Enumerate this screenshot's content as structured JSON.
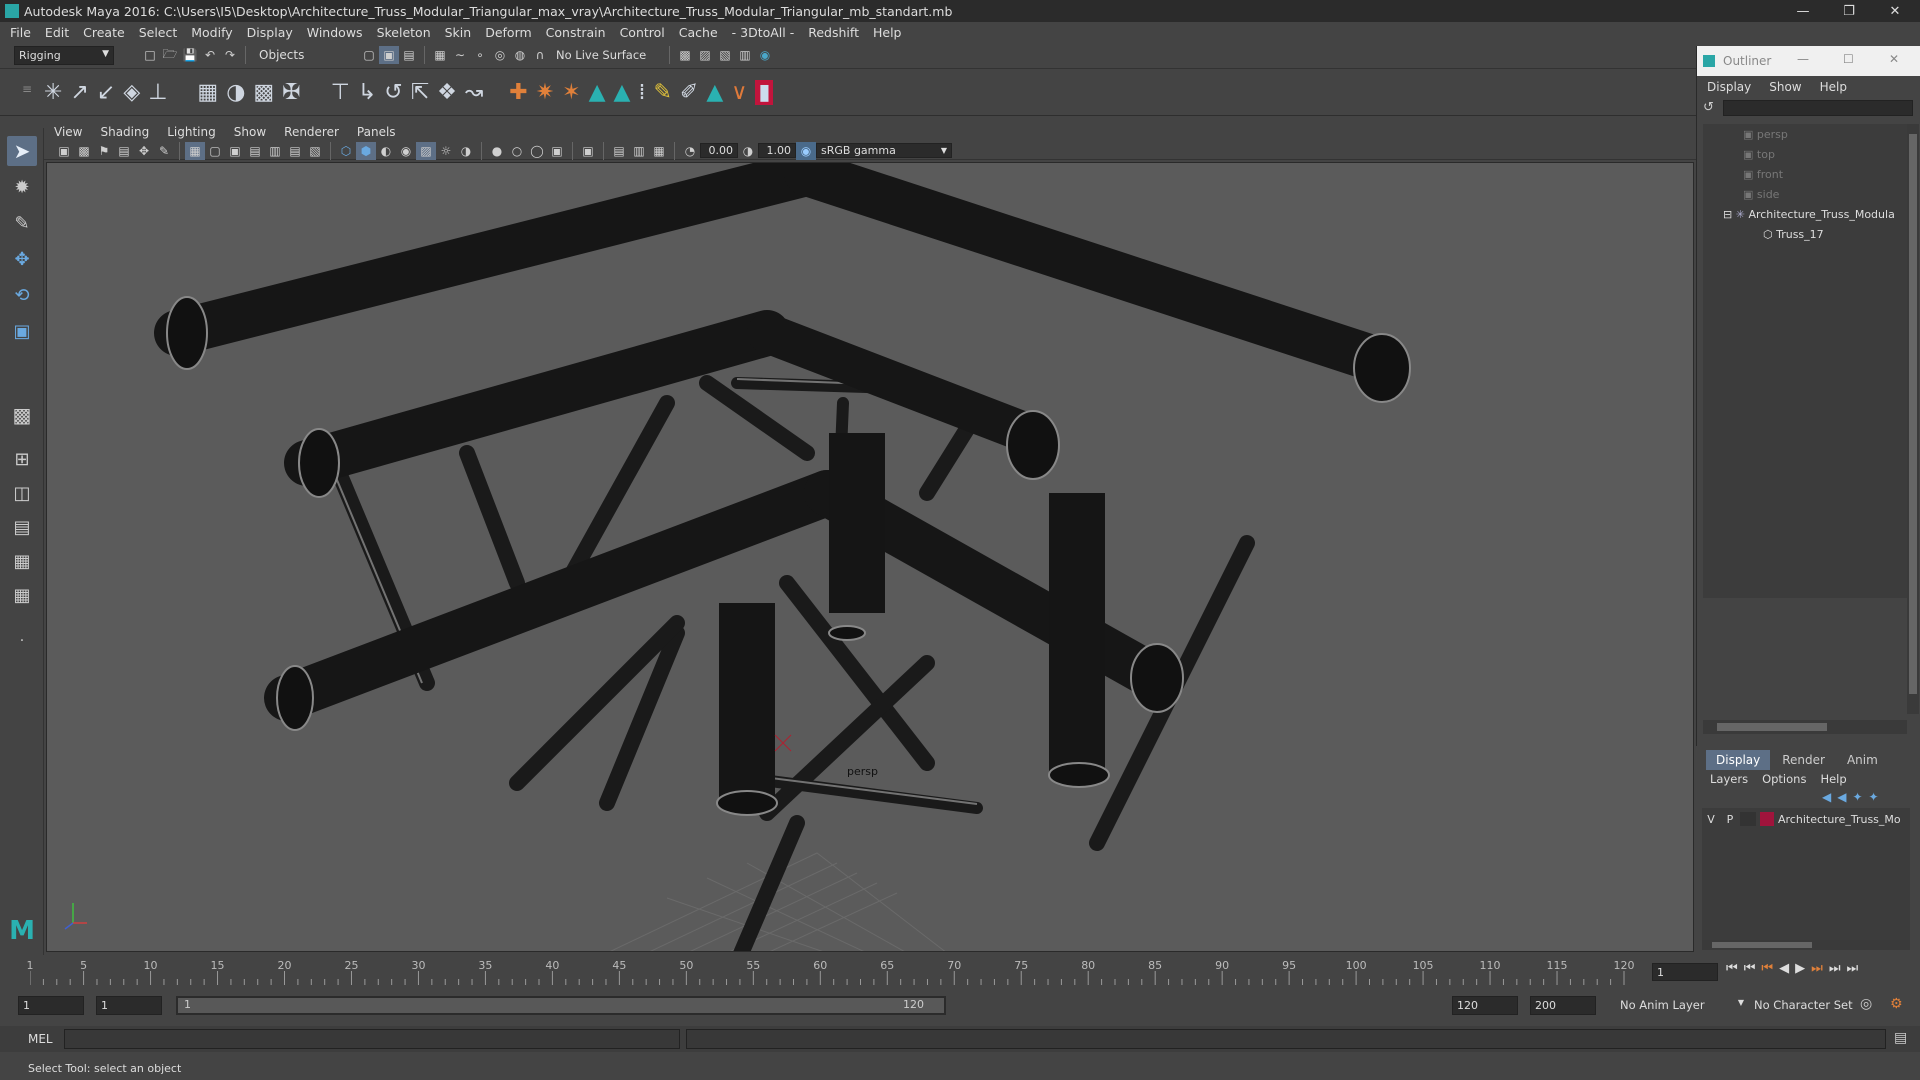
{
  "window": {
    "title": "Autodesk Maya 2016: C:\\Users\\I5\\Desktop\\Architecture_Truss_Modular_Triangular_max_vray\\Architecture_Truss_Modular_Triangular_mb_standart.mb"
  },
  "menubar": [
    "File",
    "Edit",
    "Create",
    "Select",
    "Modify",
    "Display",
    "Windows",
    "Skeleton",
    "Skin",
    "Deform",
    "Constrain",
    "Control",
    "Cache",
    "- 3DtoAll -",
    "Redshift",
    "Help"
  ],
  "statusline": {
    "menuset": "Rigging",
    "selection_mode": "Objects",
    "live_surface": "No Live Surface"
  },
  "panel_menu": [
    "View",
    "Shading",
    "Lighting",
    "Show",
    "Renderer",
    "Panels"
  ],
  "panel_tools": {
    "exposure": "0.00",
    "gamma": "1.00",
    "color_space": "sRGB gamma"
  },
  "viewport": {
    "camera_label": "persp"
  },
  "outliner": {
    "title": "Outliner",
    "menu": [
      "Display",
      "Show",
      "Help"
    ],
    "items": [
      {
        "label": "persp",
        "kind": "camera",
        "indent": 0
      },
      {
        "label": "top",
        "kind": "camera",
        "indent": 0
      },
      {
        "label": "front",
        "kind": "camera",
        "indent": 0
      },
      {
        "label": "side",
        "kind": "camera",
        "indent": 0
      },
      {
        "label": "Architecture_Truss_Modula",
        "kind": "group",
        "indent": 0
      },
      {
        "label": "Truss_17",
        "kind": "mesh",
        "indent": 1
      }
    ]
  },
  "layers": {
    "tabs": [
      "Display",
      "Render",
      "Anim"
    ],
    "menu": [
      "Layers",
      "Options",
      "Help"
    ],
    "rows": [
      {
        "v": "V",
        "p": "P",
        "name": "Architecture_Truss_Mo",
        "color": "#a0143c"
      }
    ]
  },
  "timeline": {
    "ticks": [
      "5",
      "10",
      "15",
      "20",
      "25",
      "30",
      "35",
      "40",
      "45",
      "50",
      "55",
      "60",
      "65",
      "70",
      "75",
      "80",
      "85",
      "90",
      "95",
      "100",
      "105",
      "110",
      "115",
      "120"
    ],
    "first_tick": "1",
    "current_frame": "1"
  },
  "range": {
    "start": "1",
    "playback_start": "1",
    "slider_start": "1",
    "slider_end": "120",
    "playback_end": "120",
    "end": "200",
    "anim_layer": "No Anim Layer",
    "character_set": "No Character Set"
  },
  "cmdline": {
    "label": "MEL"
  },
  "helpline": {
    "text": "Select Tool: select an object"
  }
}
